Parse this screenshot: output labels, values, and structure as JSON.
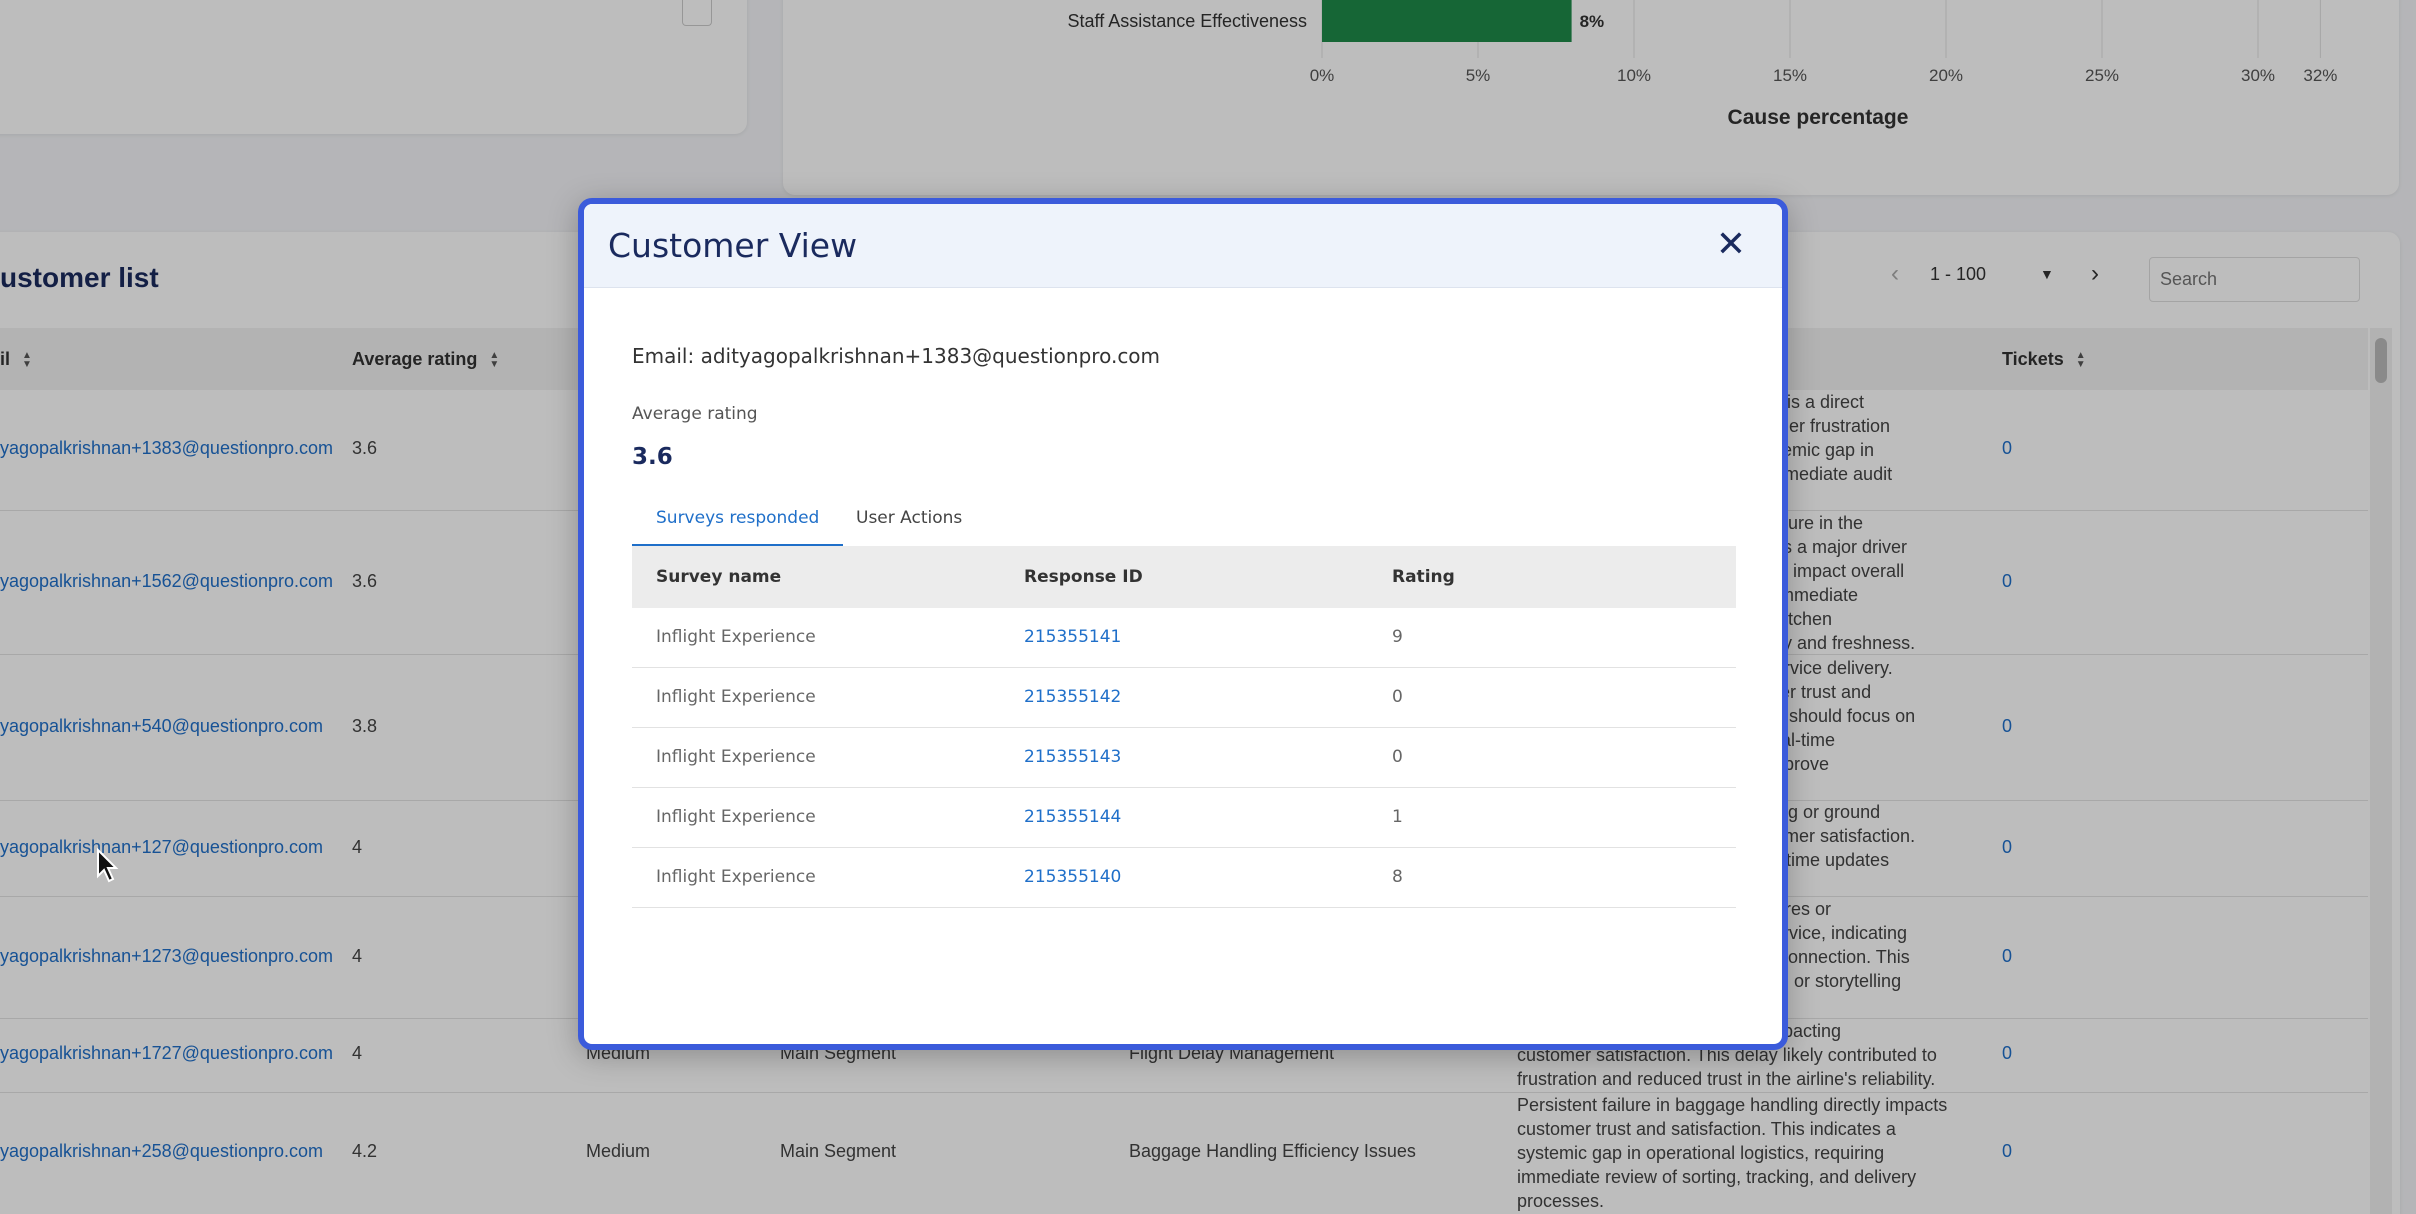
{
  "chart_data": {
    "type": "bar",
    "orientation": "horizontal",
    "categories": [
      "Staff Assistance Effectiveness"
    ],
    "values": [
      8
    ],
    "value_labels": [
      "8%"
    ],
    "bar_color": "#1e8a4a",
    "xlabel": "Cause percentage",
    "xlim": [
      0,
      32
    ],
    "xticks": [
      0,
      5,
      10,
      15,
      20,
      25,
      30,
      32
    ],
    "xtick_labels": [
      "0%",
      "5%",
      "10%",
      "15%",
      "20%",
      "25%",
      "30%",
      "32%"
    ],
    "grid": true
  },
  "customer_list": {
    "title": "ustomer list",
    "pager": {
      "range": "1 - 100",
      "prev_icon": "chevron-left-icon",
      "next_icon": "chevron-right-icon"
    },
    "search_placeholder": "Search",
    "headers": {
      "email": "il",
      "avg_rating": "Average rating",
      "tickets": "Tickets"
    },
    "rows": [
      {
        "email": "yagopalkrishnan+1383@questionpro.com",
        "rating": "3.6",
        "priority": "",
        "segment": "",
        "cause": "",
        "summary": [
          "lling is a direct",
          "stomer frustration",
          "systemic gap in",
          "g immediate audit"
        ],
        "tickets": "0"
      },
      {
        "email": "yagopalkrishnan+1562@questionpro.com",
        "rating": "3.6",
        "priority": "",
        "segment": "",
        "cause": "",
        "summary": [
          "e failure in the",
          "uty is a major driver",
          "antly impact overall",
          "nd immediate",
          "nd kitchen",
          "iency and freshness."
        ],
        "tickets": "0"
      },
      {
        "email": "yagopalkrishnan+540@questionpro.com",
        "rating": "3.8",
        "priority": "",
        "segment": "",
        "cause": "",
        "summary": [
          "e service delivery.",
          "enger trust and",
          "ams should focus on",
          "d real-time",
          "o improve"
        ],
        "tickets": "0"
      },
      {
        "email": "yagopalkrishnan+127@questionpro.com",
        "rating": "4",
        "priority": "",
        "segment": "",
        "cause": "",
        "summary": [
          "duling or ground",
          "ustomer satisfaction.",
          "real-time updates"
        ],
        "tickets": "0"
      },
      {
        "email": "yagopalkrishnan+1273@questionpro.com",
        "rating": "4",
        "priority": "",
        "segment": "",
        "cause": "",
        "summary": [
          "eatures or",
          "s service, indicating",
          "nal connection. This",
          "ation or storytelling"
        ],
        "tickets": "0"
      },
      {
        "email": "yagopalkrishnan+1727@questionpro.com",
        "rating": "4",
        "priority": "Medium",
        "segment": "Main Segment",
        "cause": "Flight Delay Management",
        "summary": [
          "y impacting",
          "customer satisfaction. This delay likely contributed to",
          "frustration and reduced trust in the airline's reliability."
        ],
        "tickets": "0"
      },
      {
        "email": "yagopalkrishnan+258@questionpro.com",
        "rating": "4.2",
        "priority": "Medium",
        "segment": "Main Segment",
        "cause": "Baggage Handling Efficiency Issues",
        "summary": [
          "Persistent failure in baggage handling directly impacts",
          "customer trust and satisfaction. This indicates a",
          "systemic gap in operational logistics, requiring",
          "immediate review of sorting, tracking, and delivery",
          "processes."
        ],
        "tickets": "0"
      }
    ]
  },
  "modal": {
    "title": "Customer View",
    "close_icon": "close-icon",
    "email_line": "Email: adityagopalkrishnan+1383@questionpro.com",
    "avg_label": "Average rating",
    "avg_value": "3.6",
    "tabs": [
      "Surveys responded",
      "User Actions"
    ],
    "active_tab": 0,
    "table": {
      "headers": [
        "Survey name",
        "Response ID",
        "Rating"
      ],
      "rows": [
        {
          "survey": "Inflight Experience",
          "response_id": "215355141",
          "rating": "9"
        },
        {
          "survey": "Inflight Experience",
          "response_id": "215355142",
          "rating": "0"
        },
        {
          "survey": "Inflight Experience",
          "response_id": "215355143",
          "rating": "0"
        },
        {
          "survey": "Inflight Experience",
          "response_id": "215355144",
          "rating": "1"
        },
        {
          "survey": "Inflight Experience",
          "response_id": "215355140",
          "rating": "8"
        }
      ]
    }
  }
}
